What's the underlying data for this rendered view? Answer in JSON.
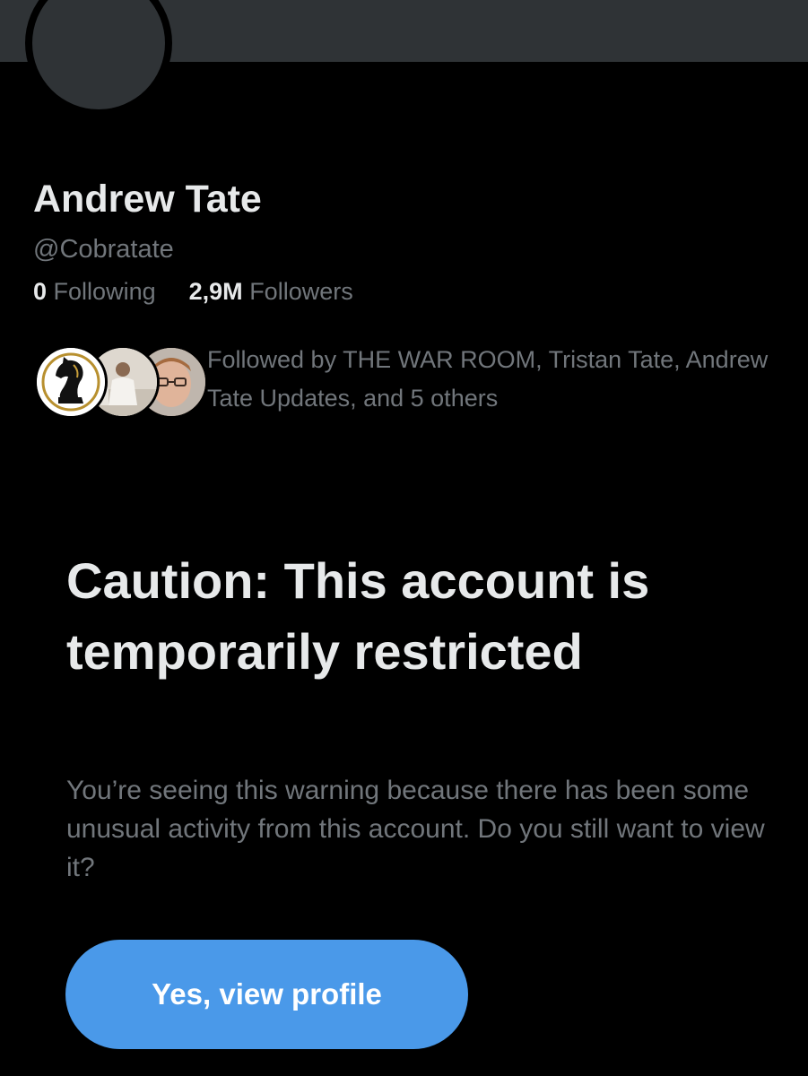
{
  "profile": {
    "display_name": "Andrew Tate",
    "handle": "@Cobratate",
    "following_count": "0",
    "following_label": "Following",
    "followers_count": "2,9M",
    "followers_label": "Followers"
  },
  "followed_by": {
    "text": "Followed by THE WAR ROOM, Tristan Tate, Andrew Tate Updates, and 5 others",
    "avatars": [
      "knight-logo-avatar",
      "man-in-white-avatar",
      "man-with-glasses-avatar"
    ]
  },
  "warning": {
    "title": "Caution: This account is temporarily restricted",
    "message": "You’re seeing this warning because there has been some unusual activity from this account. Do you still want to view it?",
    "button_label": "Yes, view profile"
  },
  "colors": {
    "background": "#000000",
    "banner": "#2f3336",
    "primary_text": "#e7e9ea",
    "secondary_text": "#71767b",
    "button": "#4a99e9"
  }
}
